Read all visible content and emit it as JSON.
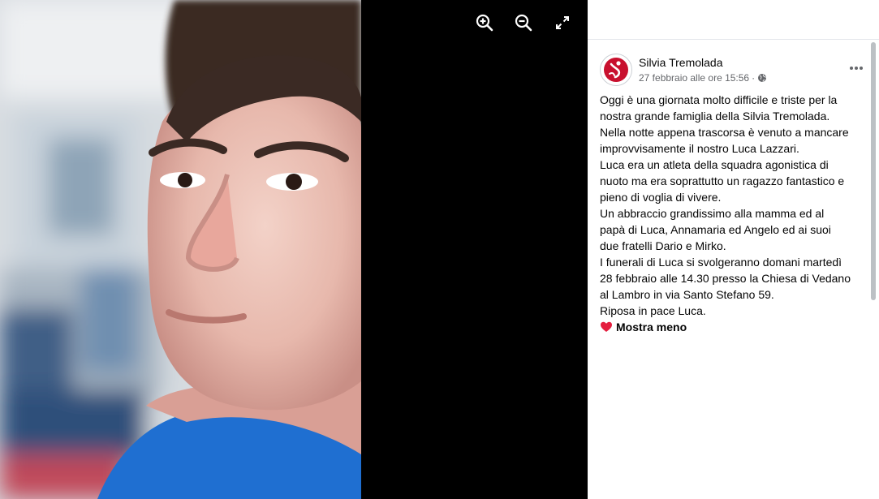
{
  "viewer": {
    "zoom_in_icon": "zoom-in-icon",
    "zoom_out_icon": "zoom-out-icon",
    "fullscreen_icon": "expand-icon"
  },
  "post": {
    "author": "Silvia Tremolada",
    "timestamp": "27 febbraio alle ore 15:56",
    "separator": "·",
    "privacy_icon": "globe-icon",
    "more_icon": "more-horizontal-icon",
    "lines": [
      "Oggi è una giornata molto difficile e triste per la",
      "nostra grande famiglia della Silvia Tremolada.",
      "Nella notte appena trascorsa è venuto a mancare",
      "improvvisamente il nostro Luca Lazzari.",
      "Luca era un atleta della squadra agonistica di",
      "nuoto ma era soprattutto un ragazzo fantastico e",
      "pieno di voglia di vivere.",
      "Un abbraccio grandissimo alla mamma ed al",
      "papà di Luca, Annamaria ed Angelo ed ai suoi",
      "due fratelli Dario e Mirko.",
      "I funerali di Luca si svolgeranno domani martedì",
      "28 febbraio alle 14.30 presso la Chiesa di Vedano",
      "al Lambro in via Santo Stefano 59.",
      "Riposa in pace Luca."
    ],
    "show_less": "Mostra meno",
    "heart_icon": "red-heart-icon"
  },
  "colors": {
    "viewer_bg": "#000000",
    "panel_bg": "#ffffff",
    "text_primary": "#050505",
    "text_secondary": "#65676b",
    "logo_red": "#c8102e"
  }
}
